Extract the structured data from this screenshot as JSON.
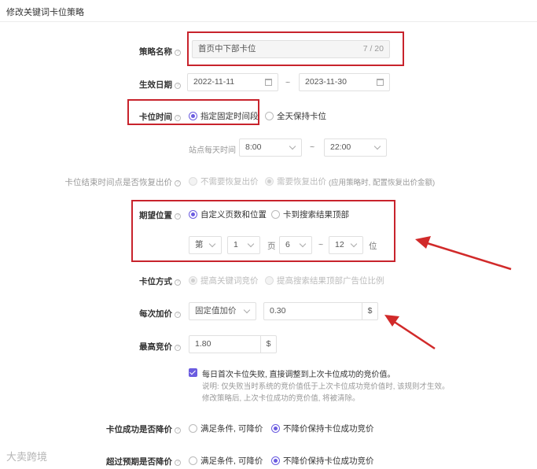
{
  "page_title": "修改关键词卡位策略",
  "form": {
    "strategy_name": {
      "label": "策略名称",
      "value": "首页中下部卡位",
      "counter": "7 / 20"
    },
    "effective_date": {
      "label": "生效日期",
      "start": "2022-11-11",
      "separator": "~",
      "end": "2023-11-30"
    },
    "slot_time": {
      "label": "卡位时间",
      "option_fixed": "指定固定时间段",
      "option_all_day": "全天保持卡位"
    },
    "site_time": {
      "label": "站点每天时间",
      "start": "8:00",
      "separator": "~",
      "end": "22:00"
    },
    "restore_bid": {
      "label": "卡位结束时间点是否恢复出价",
      "option_no": "不需要恢复出价",
      "option_yes": "需要恢复出价",
      "hint": "(应用策略时, 配置恢复出价金额)"
    },
    "position": {
      "label": "期望位置",
      "option_custom": "自定义页数和位置",
      "option_top": "卡到搜索结果顶部",
      "prefix": "第",
      "page": "1",
      "page_unit": "页",
      "pos_from": "6",
      "separator": "~",
      "pos_to": "12",
      "pos_unit": "位"
    },
    "method": {
      "label": "卡位方式",
      "option_keyword": "提高关键词竞价",
      "option_top_ratio": "提高搜索结果顶部广告位比例"
    },
    "bid_step": {
      "label": "每次加价",
      "type": "固定值加价",
      "value": "0.30",
      "currency": "$"
    },
    "max_bid": {
      "label": "最高竞价",
      "value": "1.80",
      "currency": "$"
    },
    "auto_adjust": {
      "text": "每日首次卡位失败, 直接调整到上次卡位成功的竞价值。",
      "note_1": "说明: 仅失败当时系统的竞价值低于上次卡位成功竞价值时, 该规则才生效。",
      "note_2": "修改策略后, 上次卡位成功的竞价值, 将被清除。"
    },
    "lower_on_success": {
      "label": "卡位成功是否降价",
      "option_lower": "满足条件, 可降价",
      "option_keep": "不降价保持卡位成功竞价"
    },
    "lower_on_exceed": {
      "label": "超过预期是否降价",
      "option_lower": "满足条件, 可降价",
      "option_keep": "不降价保持卡位成功竞价"
    }
  },
  "watermark": "大卖跨境",
  "colors": {
    "accent": "#6b5ce0",
    "highlight": "#c8232c"
  }
}
